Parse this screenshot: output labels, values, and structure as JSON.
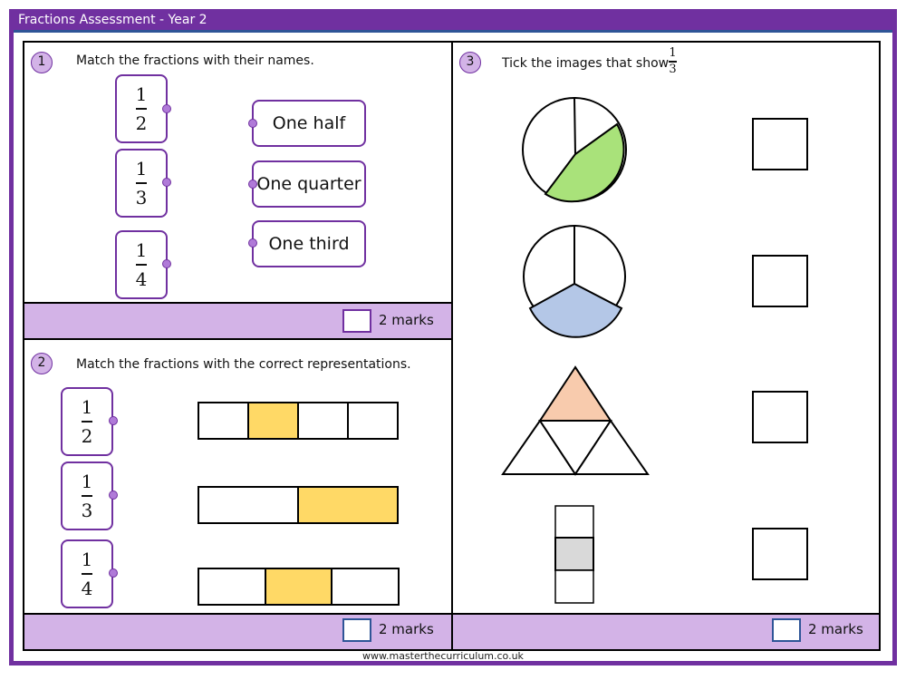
{
  "header": {
    "title": "Fractions Assessment - Year 2"
  },
  "footer": {
    "url": "www.masterthecurriculum.co.uk"
  },
  "colors": {
    "brand": "#7030a0",
    "marks_bar": "#d3b3e7",
    "accent_blue": "#2f5597",
    "green": "#a9e27a",
    "blue": "#b4c7e7",
    "orange": "#f8cbad",
    "yellow": "#ffd966",
    "grey": "#d9d9d9"
  },
  "q1": {
    "number": "1",
    "prompt": "Match the fractions with their names.",
    "fractions": [
      {
        "num": "1",
        "den": "2"
      },
      {
        "num": "1",
        "den": "3"
      },
      {
        "num": "1",
        "den": "4"
      }
    ],
    "names": [
      "One half",
      "One quarter",
      "One third"
    ],
    "marks": "2 marks"
  },
  "q2": {
    "number": "2",
    "prompt": "Match the fractions with the correct representations.",
    "fractions": [
      {
        "num": "1",
        "den": "2"
      },
      {
        "num": "1",
        "den": "3"
      },
      {
        "num": "1",
        "den": "4"
      }
    ],
    "bars": [
      {
        "parts": 4,
        "shaded": [
          1
        ]
      },
      {
        "parts": 2,
        "shaded": [
          1
        ]
      },
      {
        "parts": 3,
        "shaded": [
          1
        ]
      }
    ],
    "marks": "2 marks"
  },
  "q3": {
    "number": "3",
    "prompt": "Tick the images that show",
    "prompt_fraction": {
      "num": "1",
      "den": "3"
    },
    "images": [
      {
        "shape": "circle-unequal-3-parts",
        "shaded": "green"
      },
      {
        "shape": "circle-equal-3-parts",
        "shaded": "blue"
      },
      {
        "shape": "triangle-4-parts",
        "shaded": "orange"
      },
      {
        "shape": "column-3-parts",
        "shaded": "grey"
      }
    ],
    "marks": "2 marks"
  }
}
